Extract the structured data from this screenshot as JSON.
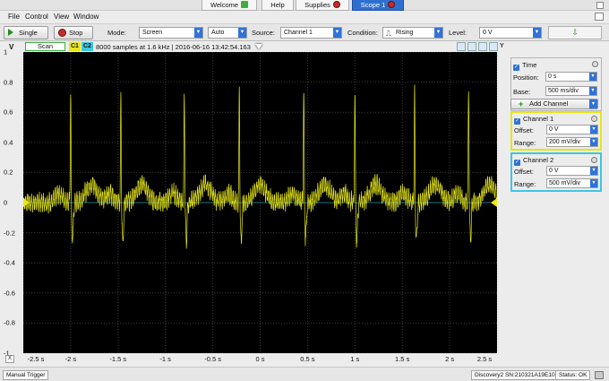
{
  "tabs": [
    {
      "label": "Welcome",
      "icon": "welcome-plus-icon"
    },
    {
      "label": "Help",
      "icon": ""
    },
    {
      "label": "Supplies",
      "icon": "supplies-status-icon"
    },
    {
      "label": "Scope 1",
      "icon": "scope-status-icon"
    }
  ],
  "menu": [
    "File",
    "Control",
    "View",
    "Window"
  ],
  "toolbar": {
    "single_label": "Single",
    "stop_label": "Stop",
    "mode_label": "Mode:",
    "mode_value": "Screen",
    "auto_value": "Auto",
    "source_label": "Source:",
    "source_value": "Channel 1",
    "condition_label": "Condition:",
    "condition_value": "Rising",
    "level_label": "Level:",
    "level_value": "0 V"
  },
  "scope": {
    "scan_label": "Scan",
    "c1": "C1",
    "c2": "C2",
    "info": "8000 samples at 1.6 kHz | 2016-06-16 13:42:54.163",
    "y_unit": "V",
    "x_menu": "X"
  },
  "colors": {
    "trace": "#e8e81a",
    "background": "#000000",
    "ch1_frame": "#e6e619",
    "ch2_frame": "#3cc7e0",
    "accent": "#2f72d8"
  },
  "chart_data": {
    "type": "line",
    "title": "",
    "xlabel": "",
    "ylabel": "V",
    "xlim": [
      -2.5,
      2.5
    ],
    "ylim": [
      -1.0,
      1.0
    ],
    "y_ticks": [
      "1",
      "0.8",
      "0.6",
      "0.4",
      "0.2",
      "0",
      "-0.2",
      "-0.4",
      "-0.6",
      "-0.8",
      "-1"
    ],
    "x_ticks": [
      "-2.5 s",
      "-2 s",
      "-1.5 s",
      "-1 s",
      "-0.5 s",
      "0 s",
      "0.5 s",
      "1 s",
      "1.5 s",
      "2 s",
      "2.5 s"
    ],
    "grid": true,
    "series": [
      {
        "name": "",
        "peaks_x": [
          -2.0,
          -1.47,
          -0.8,
          -0.22,
          0.46,
          1.0,
          1.63,
          2.2
        ],
        "peak_value": 0.75,
        "min_value": -0.28,
        "baseline": 0.0
      }
    ]
  },
  "panel": {
    "time_label": "Time",
    "position_label": "Position:",
    "position_value": "0 s",
    "base_label": "Base:",
    "base_value": "500 ms/div",
    "add_channel_label": "Add Channel",
    "ch1_label": "Channel 1",
    "ch1_offset_label": "Offset:",
    "ch1_offset_value": "0 V",
    "ch1_range_label": "Range:",
    "ch1_range_value": "200 mV/div",
    "ch2_label": "Channel 2",
    "ch2_offset_label": "Offset:",
    "ch2_offset_value": "0 V",
    "ch2_range_label": "Range:",
    "ch2_range_value": "500 mV/div"
  },
  "status": {
    "manual_trigger": "Manual Trigger",
    "device": "Discovery2 SN:210321A19E10",
    "status": "Status: OK"
  }
}
